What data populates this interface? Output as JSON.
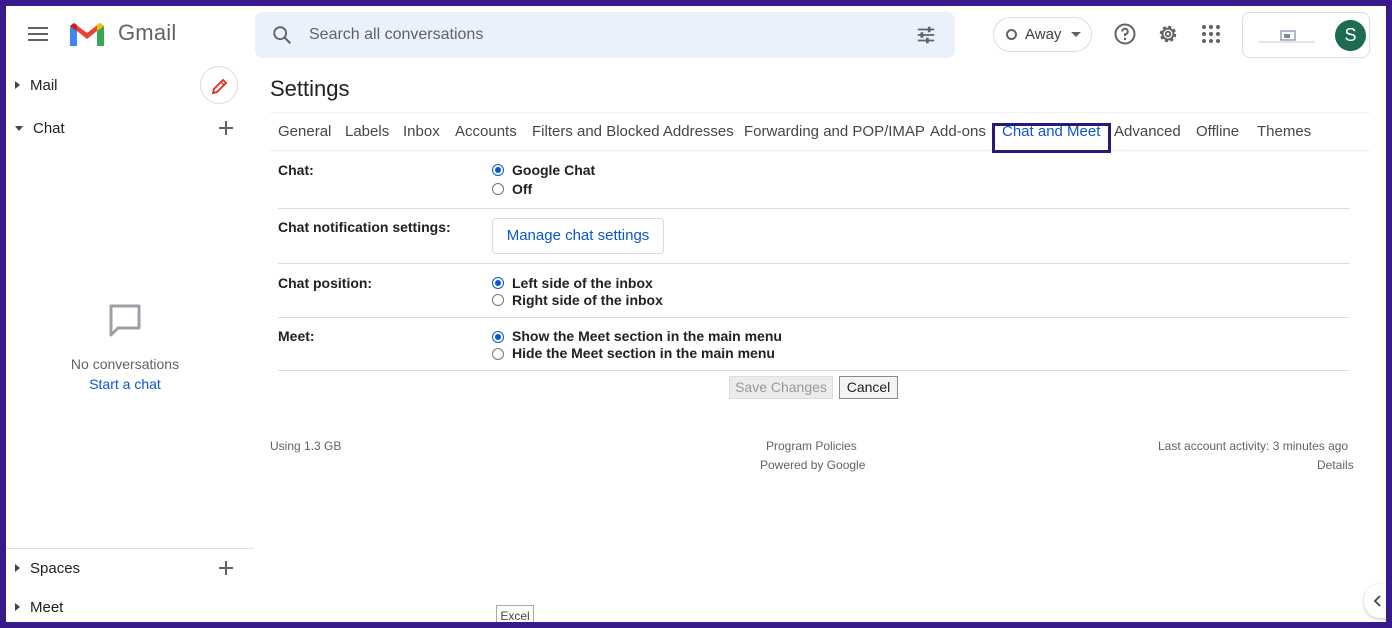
{
  "header": {
    "app_name": "Gmail",
    "search_placeholder": "Search all conversations",
    "status_label": "Away",
    "avatar_initial": "S"
  },
  "sidebar": {
    "mail_label": "Mail",
    "chat_label": "Chat",
    "empty_text": "No conversations",
    "start_chat_link": "Start a chat",
    "spaces_label": "Spaces",
    "meet_label": "Meet"
  },
  "settings": {
    "title": "Settings",
    "tabs": [
      {
        "label": "General"
      },
      {
        "label": "Labels"
      },
      {
        "label": "Inbox"
      },
      {
        "label": "Accounts"
      },
      {
        "label": "Filters and Blocked Addresses"
      },
      {
        "label": "Forwarding and POP/IMAP"
      },
      {
        "label": "Add-ons"
      },
      {
        "label": "Chat and Meet",
        "active": true
      },
      {
        "label": "Advanced"
      },
      {
        "label": "Offline"
      },
      {
        "label": "Themes"
      }
    ],
    "chat": {
      "label": "Chat:",
      "options": [
        "Google Chat",
        "Off"
      ],
      "selected": "Google Chat"
    },
    "notification": {
      "label": "Chat notification settings:",
      "button": "Manage chat settings"
    },
    "position": {
      "label": "Chat position:",
      "options": [
        "Left side of the inbox",
        "Right side of the inbox"
      ],
      "selected": "Left side of the inbox"
    },
    "meet": {
      "label": "Meet:",
      "options": [
        "Show the Meet section in the main menu",
        "Hide the Meet section in the main menu"
      ],
      "selected": "Show the Meet section in the main menu"
    },
    "save_label": "Save Changes",
    "cancel_label": "Cancel"
  },
  "footer": {
    "storage": "Using 1.3 GB",
    "program_policies": "Program Policies",
    "powered_by": "Powered by Google",
    "last_activity": "Last account activity: 3 minutes ago",
    "details": "Details"
  },
  "taskbar_tooltip": "Excel",
  "colors": {
    "accent": "#0b57d0",
    "avatar_bg": "#1e6b52",
    "frame_border": "#3a1a8a",
    "tab_highlight": "#2a1a78"
  }
}
